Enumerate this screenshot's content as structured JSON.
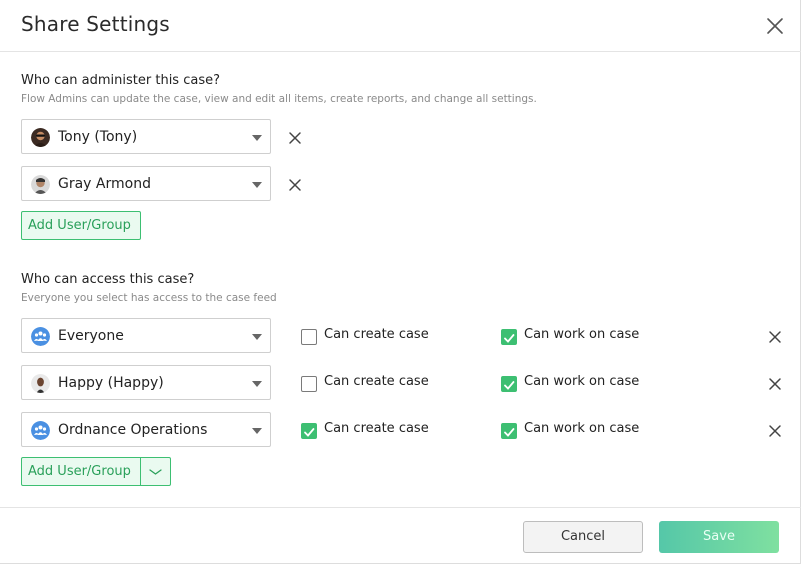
{
  "modal": {
    "title": "Share Settings"
  },
  "admin": {
    "title": "Who can administer this case?",
    "description": "Flow Admins can update the case, view and edit all items, create reports, and change all settings.",
    "users": [
      {
        "name": "Tony (Tony)",
        "avatar": "person-avatar"
      },
      {
        "name": "Gray Armond",
        "avatar": "person-avatar"
      }
    ],
    "add_label": "Add User/Group"
  },
  "access": {
    "title": "Who can access this case?",
    "description": "Everyone you select has access to the case feed",
    "create_label": "Can create case",
    "work_label": "Can work on case",
    "entries": [
      {
        "name": "Everyone",
        "avatar": "group-icon",
        "can_create": false,
        "can_work": true
      },
      {
        "name": "Happy (Happy)",
        "avatar": "person-avatar",
        "can_create": false,
        "can_work": true
      },
      {
        "name": "Ordnance Operations",
        "avatar": "group-icon",
        "can_create": true,
        "can_work": true
      }
    ],
    "add_label": "Add User/Group"
  },
  "footer": {
    "cancel_label": "Cancel",
    "save_label": "Save"
  },
  "colors": {
    "accent": "#3dbf72",
    "accent_bg": "#eafaf0",
    "group_icon": "#4a90e2"
  }
}
